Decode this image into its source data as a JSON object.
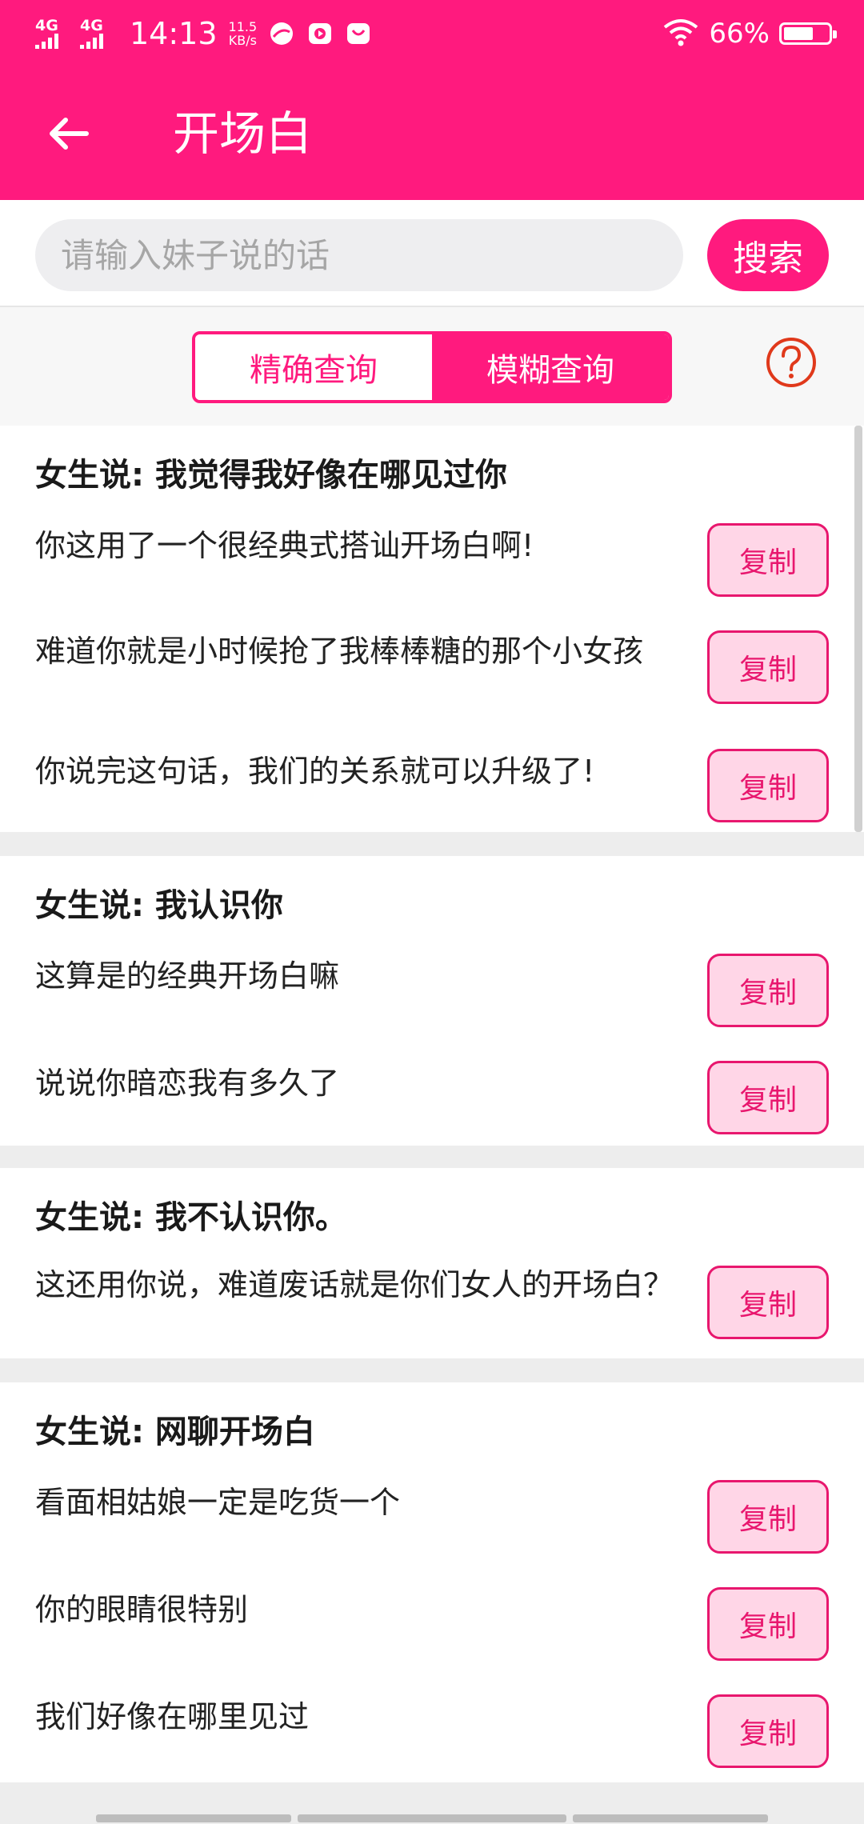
{
  "status_bar": {
    "network_1": "4G",
    "network_2": "4G",
    "time": "14:13",
    "speed_value": "11.5",
    "speed_unit": "KB/s",
    "battery": "66%",
    "battery_level": 0.66
  },
  "toolbar": {
    "title": "开场白"
  },
  "search": {
    "placeholder": "请输入妹子说的话",
    "button": "搜索"
  },
  "modes": {
    "exact": "精确查询",
    "fuzzy": "模糊查询",
    "selected": "fuzzy"
  },
  "copy_label": "复制",
  "groups": [
    {
      "title": "女生说: 我觉得我好像在哪见过你",
      "replies": [
        "你这用了一个很经典式搭讪开场白啊!",
        "难道你就是小时候抢了我棒棒糖的那个小女孩",
        "你说完这句话，我们的关系就可以升级了!"
      ]
    },
    {
      "title": "女生说: 我认识你",
      "replies": [
        "这算是的经典开场白嘛",
        "说说你暗恋我有多久了"
      ]
    },
    {
      "title": "女生说: 我不认识你。",
      "replies": [
        "这还用你说，难道废话就是你们女人的开场白？"
      ]
    },
    {
      "title": "女生说: 网聊开场白",
      "replies": [
        "看面相姑娘一定是吃货一个",
        "你的眼睛很特别",
        "我们好像在哪里见过"
      ]
    }
  ],
  "colors": {
    "primary": "#ff1a7e",
    "copy_bg": "#ffd6e7",
    "copy_border": "#e8176e"
  }
}
